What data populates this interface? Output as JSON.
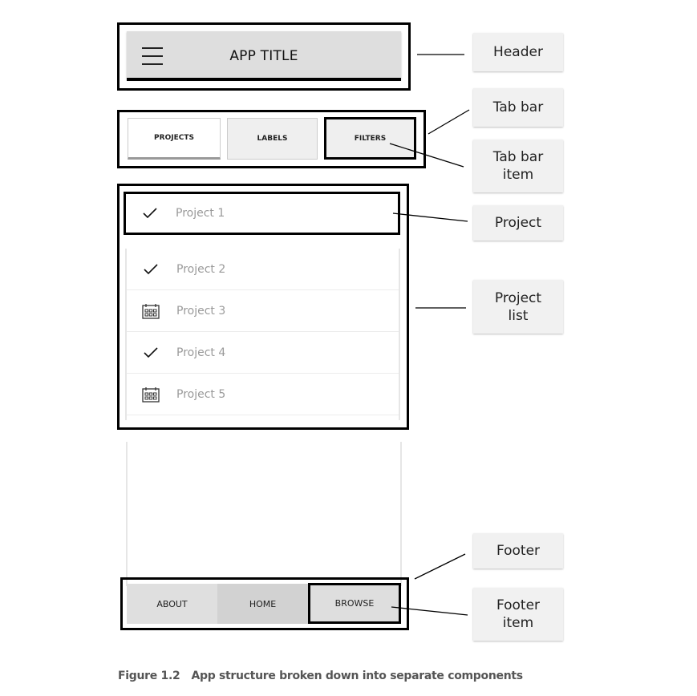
{
  "header": {
    "title": "APP TITLE",
    "menu_icon": "hamburger-menu-icon"
  },
  "tab_bar": {
    "tabs": [
      {
        "label": "PROJECTS",
        "state": "active"
      },
      {
        "label": "LABELS",
        "state": "inactive"
      },
      {
        "label": "FILTERS",
        "state": "inactive"
      }
    ]
  },
  "projects": {
    "selected": {
      "label": "Project 1",
      "icon": "checkmark-icon"
    },
    "items": [
      {
        "label": "Project 2",
        "icon": "checkmark-icon"
      },
      {
        "label": "Project 3",
        "icon": "calendar-icon"
      },
      {
        "label": "Project 4",
        "icon": "checkmark-icon"
      },
      {
        "label": "Project 5",
        "icon": "calendar-icon"
      }
    ]
  },
  "footer": {
    "items": [
      {
        "label": "ABOUT"
      },
      {
        "label": "HOME"
      },
      {
        "label": "BROWSE"
      }
    ]
  },
  "callouts": {
    "header": "Header",
    "tab_bar": "Tab bar",
    "tab_bar_item": "Tab bar\nitem",
    "project": "Project",
    "project_list": "Project\nlist",
    "footer": "Footer",
    "footer_item": "Footer\nitem"
  },
  "caption": {
    "number": "Figure 1.2",
    "text": "App structure broken down into separate components"
  },
  "colors": {
    "header_bg": "#dedede",
    "tab_inactive_bg": "#efefef",
    "footer_about_bg": "#dfdfdf",
    "footer_home_bg": "#d2d2d2",
    "footer_browse_bg": "#dedede",
    "callout_bg": "#f1f1f1",
    "outline": "#000000"
  }
}
